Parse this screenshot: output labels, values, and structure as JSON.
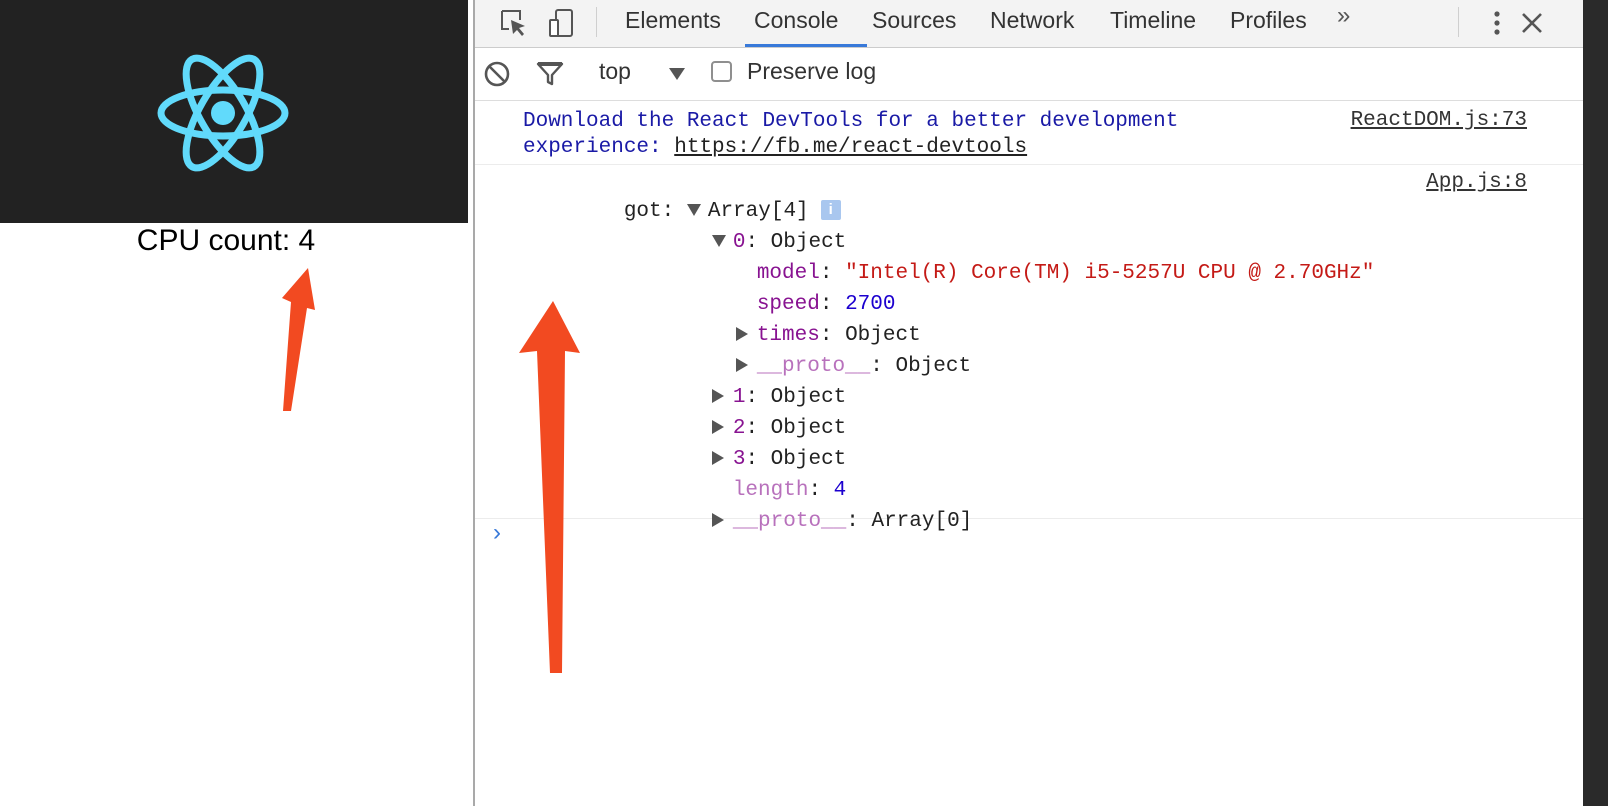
{
  "app": {
    "logo_icon": "react-logo-icon",
    "cpu_count_text": "CPU count: 4"
  },
  "devtools": {
    "tabs": [
      "Elements",
      "Console",
      "Sources",
      "Network",
      "Timeline",
      "Profiles"
    ],
    "active_tab": "Console",
    "more_tabs": "»",
    "toolbar": {
      "context": "top",
      "preserve_log_label": "Preserve log",
      "preserve_log_checked": false
    },
    "console": {
      "message1": {
        "text": "Download the React DevTools for a better development",
        "text_line2": "experience: ",
        "link": "https://fb.me/react-devtools",
        "source": "ReactDOM.js:73"
      },
      "message2": {
        "prefix": "got: ",
        "array_label": "Array[4]",
        "info_badge": "i",
        "source": "App.js:8",
        "item0_key": "0",
        "item0_type": "Object",
        "model_key": "model",
        "model_value": "\"Intel(R) Core(TM) i5-5257U CPU @ 2.70GHz\"",
        "speed_key": "speed",
        "speed_value": "2700",
        "times_key": "times",
        "times_value": "Object",
        "proto_key": "__proto__",
        "proto_value": "Object",
        "item1_key": "1",
        "item1_type": "Object",
        "item2_key": "2",
        "item2_type": "Object",
        "item3_key": "3",
        "item3_type": "Object",
        "length_key": "length",
        "length_value": "4",
        "array_proto_key": "__proto__",
        "array_proto_value": "Array[0]"
      },
      "prompt_symbol": "›"
    }
  },
  "colors": {
    "annotation_arrow": "#f24a21",
    "react_blue": "#61dafb",
    "header_dark": "#222222",
    "tab_accent": "#3879d9"
  }
}
